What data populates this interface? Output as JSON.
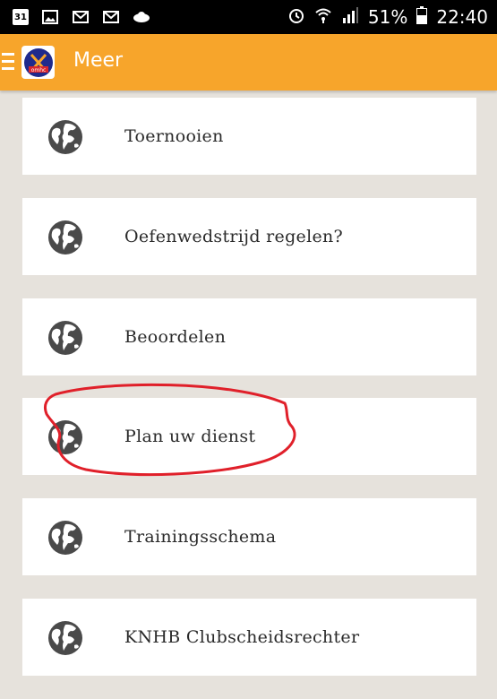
{
  "status_bar": {
    "calendar_day": "31",
    "battery": "51%",
    "time": "22:40"
  },
  "app_bar": {
    "title": "Meer",
    "logo_text": "omhc"
  },
  "menu": {
    "items": [
      {
        "label": "Toernooien",
        "icon": "globe-icon"
      },
      {
        "label": "Oefenwedstrijd regelen?",
        "icon": "globe-icon"
      },
      {
        "label": "Beoordelen",
        "icon": "globe-icon"
      },
      {
        "label": "Plan uw dienst",
        "icon": "globe-icon"
      },
      {
        "label": "Trainingsschema",
        "icon": "globe-icon"
      },
      {
        "label": "KNHB Clubscheidsrechter",
        "icon": "globe-icon"
      }
    ]
  },
  "colors": {
    "app_bar": "#f7a52b",
    "background": "#e6e2dc",
    "annotation": "#e0202a"
  }
}
